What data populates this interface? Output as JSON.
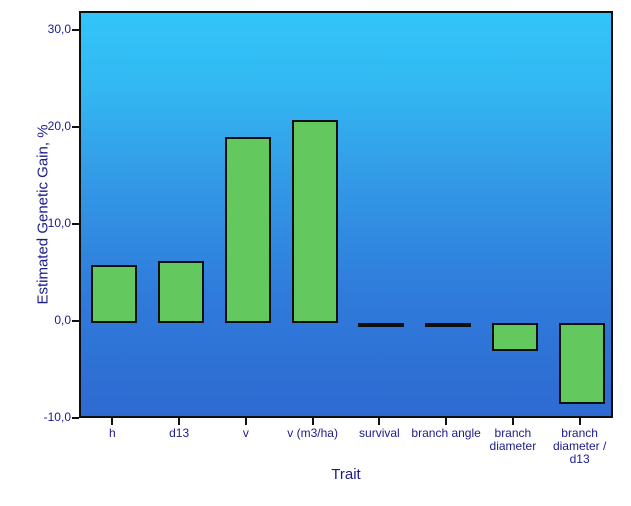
{
  "chart_data": {
    "type": "bar",
    "title": "",
    "xlabel": "Trait",
    "ylabel": "Estimated Genetic Gain, %",
    "categories": [
      "h",
      "d13",
      "v",
      "v (m3/ha)",
      "survival",
      "branch angle",
      "branch diameter",
      "branch diameter / d13"
    ],
    "values": [
      6.0,
      6.4,
      19.2,
      21.0,
      0.05,
      0.05,
      -2.9,
      -8.3
    ],
    "ylim": [
      -10.0,
      32.0
    ],
    "yticks": [
      30.0,
      20.0,
      10.0,
      0.0,
      -10.0
    ],
    "ytick_labels": [
      "30,0",
      "20,0",
      "10,0",
      "0,0",
      "-10,0"
    ],
    "grid": false,
    "legend": "none",
    "bar_color": "#63c85e",
    "bar_border_color": "#101010",
    "text_color": "#1b1b8e",
    "plot_bg_top": "#31c5fa",
    "plot_bg_bottom": "#2e6ad1"
  },
  "axes": {
    "y_title": "Estimated Genetic Gain, %",
    "x_title": "Trait",
    "y_labels": [
      "30,0",
      "20,0",
      "10,0",
      "0,0",
      "-10,0"
    ],
    "x_labels": [
      "h",
      "d13",
      "v",
      "v (m3/ha)",
      "survival",
      "branch angle",
      "branch diameter",
      "branch diameter / d13"
    ]
  }
}
